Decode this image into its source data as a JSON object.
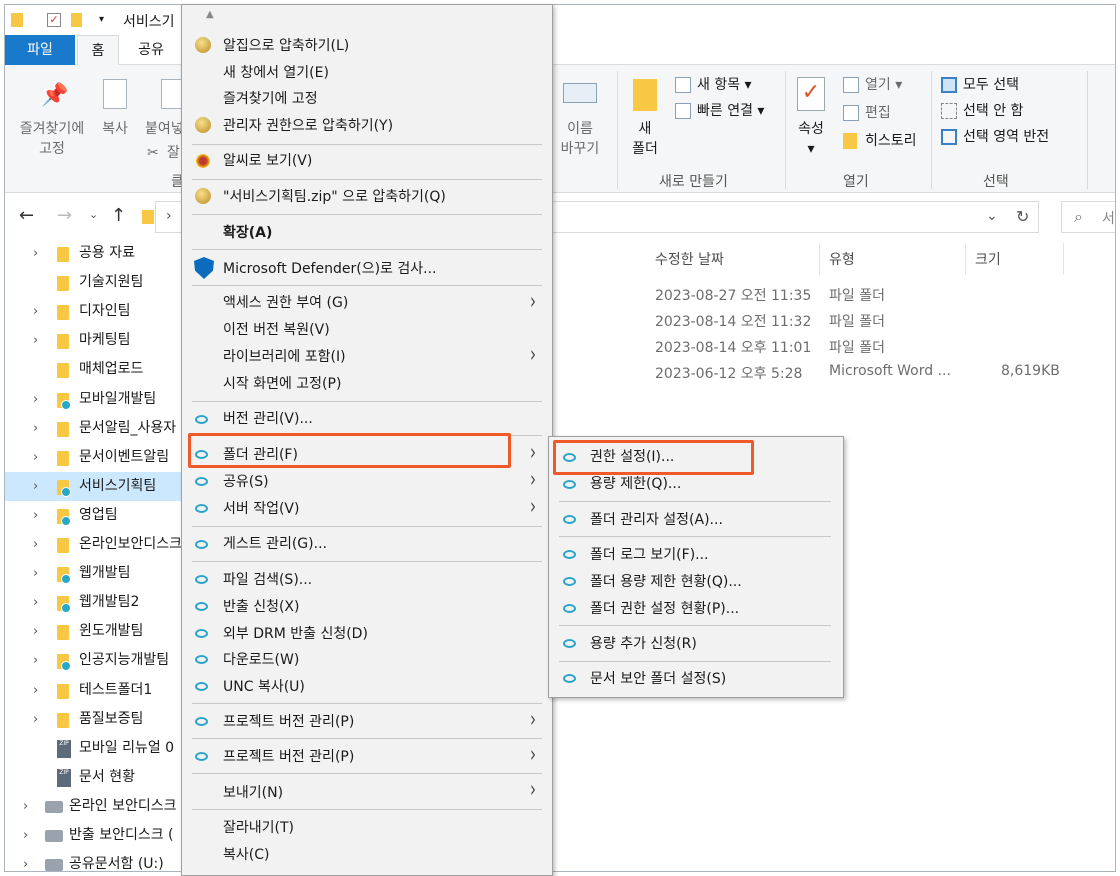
{
  "title_bar": {
    "title": "서비스기"
  },
  "ribbon": {
    "tabs": [
      "파일",
      "홈",
      "공유"
    ],
    "pin_label_1": "즐겨찾기에",
    "pin_label_2": "고정",
    "copy_label": "복사",
    "paste_label": "붙여넣",
    "cut_label": "잘",
    "clipboard_group": "클",
    "rename_label_1": "이름",
    "rename_label_2": "바꾸기",
    "new_folder_label_1": "새",
    "new_folder_label_2": "폴더",
    "new_item_label": "새 항목 ▾",
    "easy_access_label": "빠른 연결 ▾",
    "new_group": "새로 만들기",
    "properties_label": "속성",
    "properties_arrow": "▾",
    "open_label": "열기 ▾",
    "edit_label": "편집",
    "history_label": "히스토리",
    "open_group": "열기",
    "select_all_label": "모두 선택",
    "select_none_label": "선택 안 함",
    "invert_label": "선택 영역 반전",
    "select_group": "선택"
  },
  "nav": {
    "search_placeholder": "서"
  },
  "tree": [
    {
      "label": "공용 자료",
      "type": "folder",
      "chevron": true
    },
    {
      "label": "기술지원팀",
      "type": "folder",
      "chevron": false
    },
    {
      "label": "디자인팀",
      "type": "folder",
      "chevron": true
    },
    {
      "label": "마케팅팀",
      "type": "folder",
      "chevron": true
    },
    {
      "label": "매체업로드",
      "type": "folder",
      "chevron": false
    },
    {
      "label": "모바일개발팀",
      "type": "share",
      "chevron": true
    },
    {
      "label": "문서알림_사용자",
      "type": "folder",
      "chevron": true
    },
    {
      "label": "문서이벤트알림",
      "type": "folder",
      "chevron": true
    },
    {
      "label": "서비스기획팀",
      "type": "share",
      "chevron": true,
      "selected": true
    },
    {
      "label": "영업팀",
      "type": "share",
      "chevron": true
    },
    {
      "label": "온라인보안디스크",
      "type": "folder",
      "chevron": true
    },
    {
      "label": "웹개발팀",
      "type": "share",
      "chevron": true
    },
    {
      "label": "웹개발팀2",
      "type": "share",
      "chevron": true
    },
    {
      "label": "윈도개발팀",
      "type": "folder",
      "chevron": true
    },
    {
      "label": "인공지능개발팀",
      "type": "share",
      "chevron": true
    },
    {
      "label": "테스트폴더1",
      "type": "folder",
      "chevron": true
    },
    {
      "label": "품질보증팀",
      "type": "folder",
      "chevron": true
    },
    {
      "label": "모바일 리뉴얼 0",
      "type": "zip",
      "chevron": false
    },
    {
      "label": "문서 현황",
      "type": "zip",
      "chevron": false
    },
    {
      "label": "온라인 보안디스크",
      "type": "drive",
      "chevron": true
    },
    {
      "label": "반출 보안디스크 (",
      "type": "drive",
      "chevron": true
    },
    {
      "label": "공유문서함 (U:)",
      "type": "drive",
      "chevron": true
    }
  ],
  "file_list": {
    "headers": [
      "수정한 날짜",
      "유형",
      "크기"
    ],
    "rows": [
      {
        "date": "2023-08-27 오전 11:35",
        "type": "파일 폴더",
        "size": ""
      },
      {
        "date": "2023-08-14 오전 11:32",
        "type": "파일 폴더",
        "size": ""
      },
      {
        "date": "2023-08-14 오후 11:01",
        "type": "파일 폴더",
        "size": ""
      },
      {
        "date": "2023-06-12 오후 5:28",
        "type": "Microsoft Word ...",
        "size": "8,619KB"
      }
    ]
  },
  "context_menu": {
    "scroll_up": "▲",
    "items": {
      "alzip_compress": "알집으로 압축하기(L)",
      "open_new_window": "새 창에서 열기(E)",
      "pin_quick": "즐겨찾기에 고정",
      "admin_compress": "관리자 권한으로 압축하기(Y)",
      "alsee_view": "알씨로 보기(V)",
      "compress_zip": "\"서비스기획팀.zip\" 으로 압축하기(Q)",
      "expand": "확장(A)",
      "defender_scan": "Microsoft Defender(으)로 검사...",
      "grant_access": "액세스 권한 부여 (G)",
      "restore_prev": "이전 버전 복원(V)",
      "include_library": "라이브러리에 포함(I)",
      "pin_start": "시작 화면에 고정(P)",
      "version_manage": "버전 관리(V)...",
      "folder_manage": "폴더 관리(F)",
      "share": "공유(S)",
      "server_work": "서버 작업(V)",
      "guest_manage": "게스트 관리(G)...",
      "file_search": "파일 검색(S)...",
      "export_request": "반출 신청(X)",
      "external_drm": "외부 DRM 반출 신청(D)",
      "download": "다운로드(W)",
      "unc_copy": "UNC 복사(U)",
      "project_version_1": "프로젝트 버전 관리(P)",
      "project_version_2": "프로젝트 버전 관리(P)",
      "send_to": "보내기(N)",
      "cut": "잘라내기(T)",
      "copy": "복사(C)"
    }
  },
  "submenu": {
    "items": {
      "permission_settings": "권한 설정(I)...",
      "quota_limit": "용량 제한(Q)...",
      "folder_admin": "폴더 관리자 설정(A)...",
      "folder_log": "폴더 로그 보기(F)...",
      "quota_status": "폴더 용량 제한 현황(Q)...",
      "permission_status": "폴더 권한 설정 현황(P)...",
      "quota_request": "용량 추가 신청(R)",
      "secure_folder": "문서 보안 폴더 설정(S)"
    }
  },
  "colors": {
    "highlight": "#f05a28",
    "file_tab": "#1979ca",
    "selected_row": "#cce8ff"
  }
}
